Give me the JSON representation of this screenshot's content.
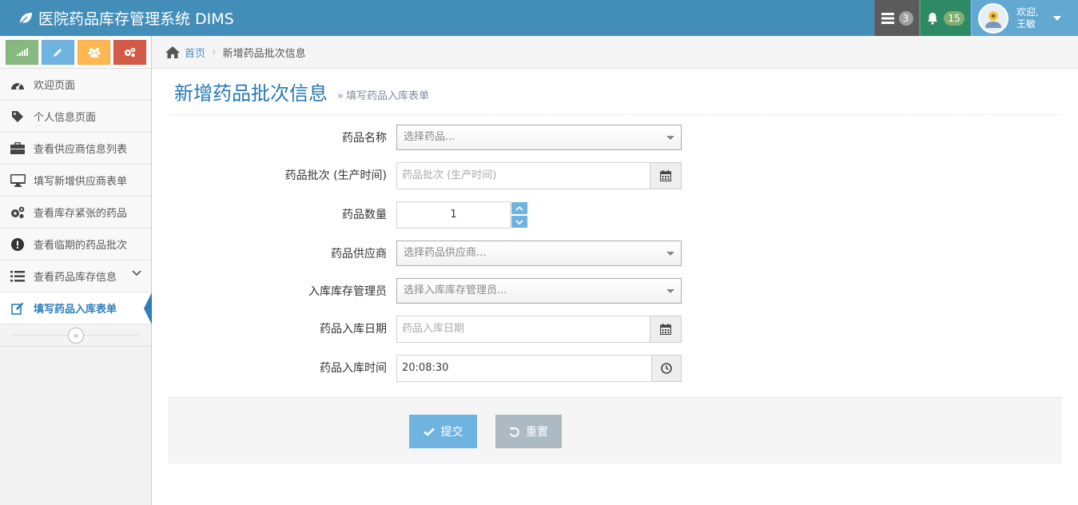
{
  "app": {
    "title": "医院药品库存管理系统 DIMS",
    "accent": "#438eb9"
  },
  "navbar": {
    "tasks_count": "3",
    "notifications_count": "15",
    "user_greeting": "欢迎,",
    "user_name": "王敏"
  },
  "sidebar": {
    "shortcuts": [
      {
        "icon": "signal-icon",
        "color": "#87b87f"
      },
      {
        "icon": "pencil-icon",
        "color": "#6fb3e0"
      },
      {
        "icon": "users-icon",
        "color": "#ffb752"
      },
      {
        "icon": "cogs-icon",
        "color": "#d15b47"
      }
    ],
    "items": [
      {
        "label": "欢迎页面",
        "icon": "tachometer-icon"
      },
      {
        "label": "个人信息页面",
        "icon": "tag-icon"
      },
      {
        "label": "查看供应商信息列表",
        "icon": "briefcase-icon"
      },
      {
        "label": "填写新增供应商表单",
        "icon": "desktop-icon"
      },
      {
        "label": "查看库存紧张的药品",
        "icon": "cogs-icon"
      },
      {
        "label": "查看临期的药品批次",
        "icon": "exclamation-circle-icon"
      },
      {
        "label": "查看药品库存信息",
        "icon": "list-icon"
      },
      {
        "label": "填写药品入库表单",
        "icon": "pencil-square-icon",
        "active": true
      }
    ],
    "collapse_symbol": "«"
  },
  "breadcrumb": {
    "home": "首页",
    "current": "新增药品批次信息"
  },
  "page_header": {
    "title": "新增药品批次信息",
    "subtitle": "填写药品入库表单"
  },
  "form": {
    "drug_name": {
      "label": "药品名称",
      "placeholder": "选择药品..."
    },
    "batch": {
      "label": "药品批次 (生产时间)",
      "placeholder": "药品批次 (生产时间)"
    },
    "quantity": {
      "label": "药品数量",
      "value": "1"
    },
    "supplier": {
      "label": "药品供应商",
      "placeholder": "选择药品供应商..."
    },
    "manager": {
      "label": "入库库存管理员",
      "placeholder": "选择入库库存管理员..."
    },
    "date": {
      "label": "药品入库日期",
      "placeholder": "药品入库日期"
    },
    "time": {
      "label": "药品入库时间",
      "value": "20:08:30"
    }
  },
  "actions": {
    "submit": "提交",
    "reset": "重置"
  }
}
